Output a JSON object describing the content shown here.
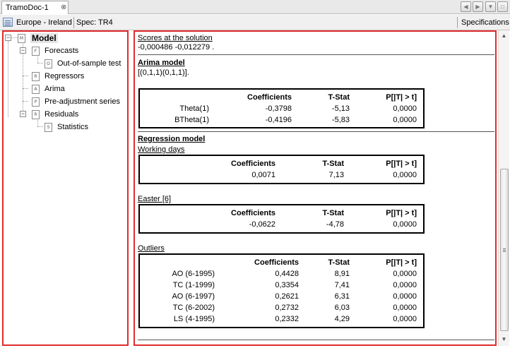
{
  "tab": {
    "title": "TramoDoc-1",
    "close_glyph": "⊗"
  },
  "toolbar": {
    "series_name": "Europe - Ireland",
    "spec": "Spec: TR4",
    "specifications_label": "Specifications"
  },
  "tree": {
    "root": "Model",
    "items": [
      {
        "label": "Forecasts",
        "icon_letter": "F"
      },
      {
        "label": "Out-of-sample test",
        "icon_letter": "O"
      },
      {
        "label": "Regressors",
        "icon_letter": "R"
      },
      {
        "label": "Arima",
        "icon_letter": "A"
      },
      {
        "label": "Pre-adjustment series",
        "icon_letter": "P"
      },
      {
        "label": "Residuals",
        "icon_letter": "R"
      },
      {
        "label": "Statistics",
        "icon_letter": "S"
      }
    ],
    "root_icon_letter": "M"
  },
  "scores": {
    "title": "Scores at the solution",
    "values": "-0,000486 -0,012279 ."
  },
  "arima": {
    "title": "Arima model",
    "spec": "[(0,1,1)(0,1,1)].",
    "headers": [
      "Coefficients",
      "T-Stat",
      "P[|T| > t]"
    ],
    "rows": [
      {
        "name": "Theta(1)",
        "coef": "-0,3798",
        "tstat": "-5,13",
        "p": "0,0000"
      },
      {
        "name": "BTheta(1)",
        "coef": "-0,4196",
        "tstat": "-5,83",
        "p": "0,0000"
      }
    ]
  },
  "regression": {
    "title": "Regression model",
    "working_days": {
      "title": "Working days",
      "headers": [
        "Coefficients",
        "T-Stat",
        "P[|T| > t]"
      ],
      "rows": [
        {
          "coef": "0,0071",
          "tstat": "7,13",
          "p": "0,0000"
        }
      ]
    },
    "easter": {
      "title": "Easter [6]",
      "headers": [
        "Coefficients",
        "T-Stat",
        "P[|T| > t]"
      ],
      "rows": [
        {
          "coef": "-0,0622",
          "tstat": "-4,78",
          "p": "0,0000"
        }
      ]
    },
    "outliers": {
      "title": "Outliers",
      "headers": [
        "Coefficients",
        "T-Stat",
        "P[|T| > t]"
      ],
      "rows": [
        {
          "name": "AO (6-1995)",
          "coef": "0,4428",
          "tstat": "8,91",
          "p": "0,0000"
        },
        {
          "name": "TC (1-1999)",
          "coef": "0,3354",
          "tstat": "7,41",
          "p": "0,0000"
        },
        {
          "name": "AO (6-1997)",
          "coef": "0,2621",
          "tstat": "6,31",
          "p": "0,0000"
        },
        {
          "name": "TC (6-2002)",
          "coef": "0,2732",
          "tstat": "6,03",
          "p": "0,0000"
        },
        {
          "name": "LS (4-1995)",
          "coef": "0,2332",
          "tstat": "4,29",
          "p": "0,0000"
        }
      ]
    }
  },
  "colors": {
    "highlight_border": "#e02b2b",
    "tab_bar": "#e9e9e9"
  }
}
